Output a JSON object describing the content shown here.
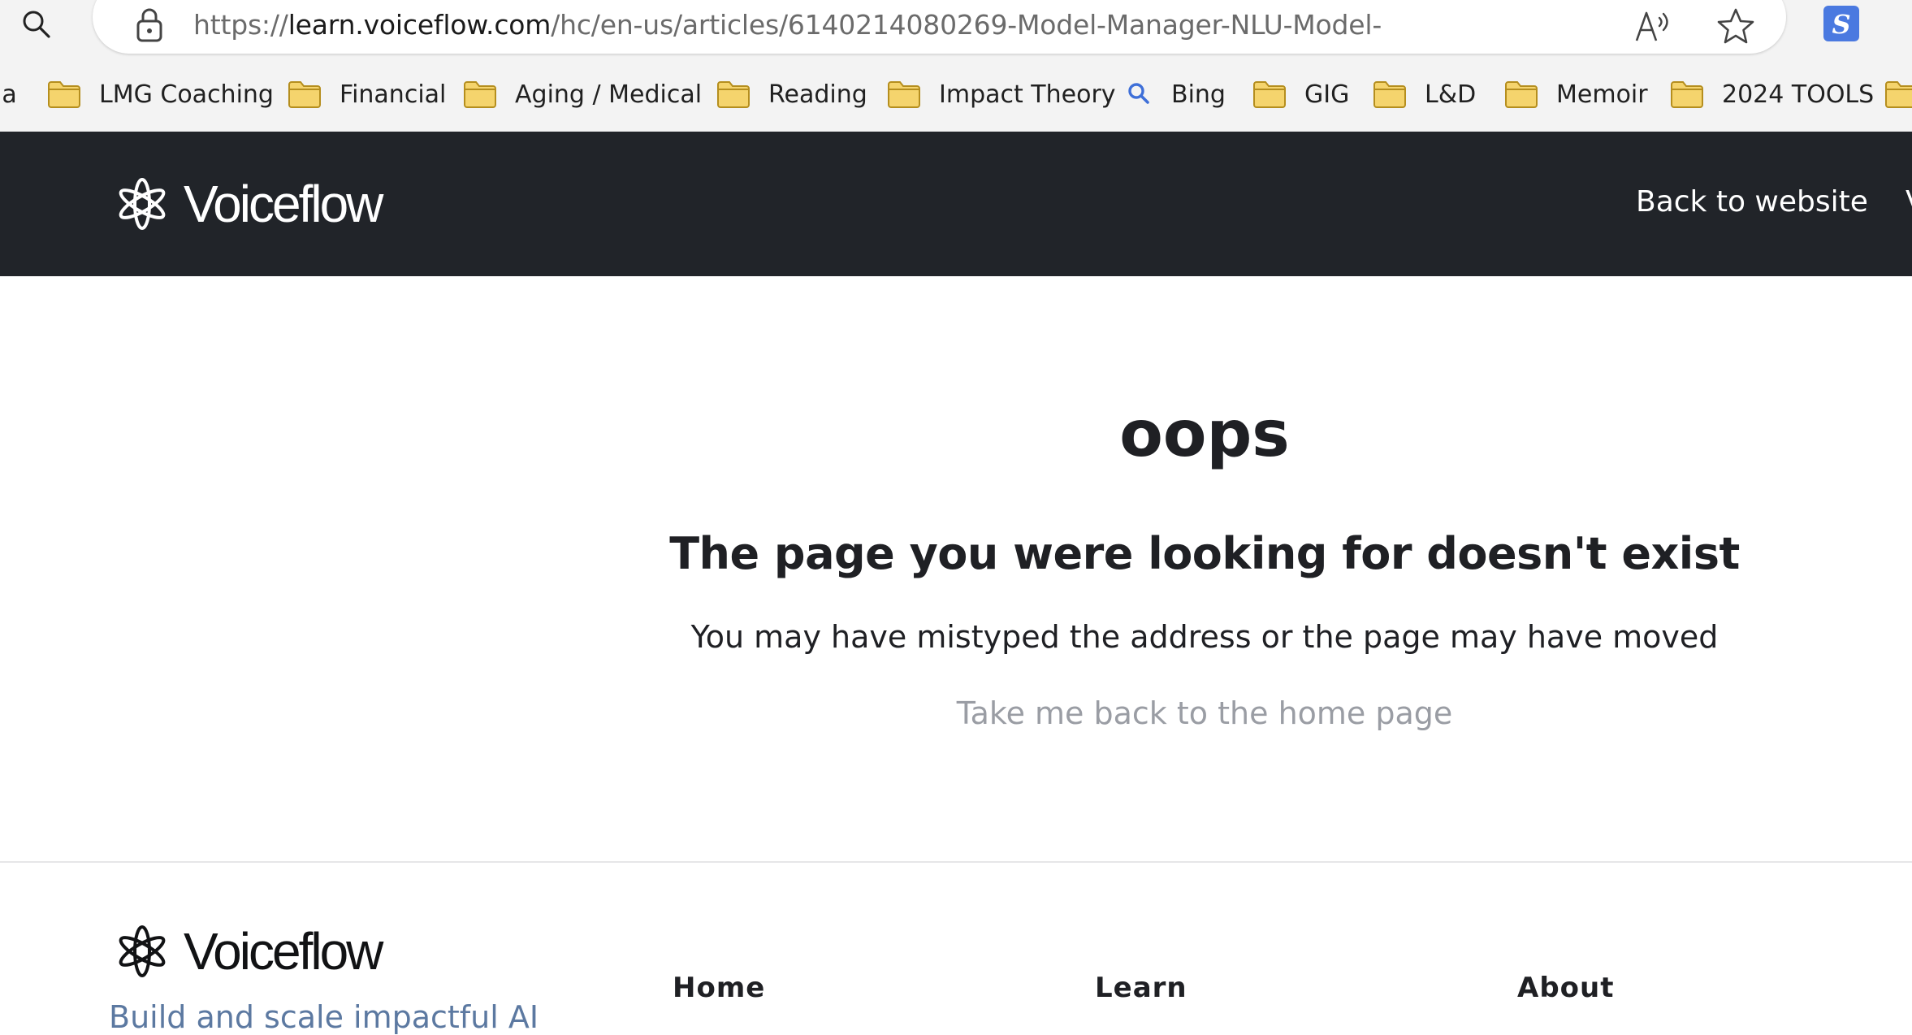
{
  "browser": {
    "url_prefix": "https://",
    "url_host": "learn.voiceflow.com",
    "url_path": "/hc/en-us/articles/6140214080269-Model-Manager-NLU-Model-",
    "bookmarks": [
      {
        "label": "ia",
        "icon": "none"
      },
      {
        "label": "LMG Coaching",
        "icon": "folder-icon"
      },
      {
        "label": "Financial",
        "icon": "folder-icon"
      },
      {
        "label": "Aging / Medical",
        "icon": "folder-icon"
      },
      {
        "label": "Reading",
        "icon": "folder-icon"
      },
      {
        "label": "Impact Theory",
        "icon": "folder-icon"
      },
      {
        "label": "Bing",
        "icon": "search-icon"
      },
      {
        "label": "GIG",
        "icon": "folder-icon"
      },
      {
        "label": "L&D",
        "icon": "folder-icon"
      },
      {
        "label": "Memoir",
        "icon": "folder-icon"
      },
      {
        "label": "2024 TOOLS",
        "icon": "folder-icon"
      }
    ]
  },
  "header": {
    "logo_text": "Voiceflow",
    "back_link": "Back to website",
    "edge_glyph": "V"
  },
  "main": {
    "title": "oops",
    "subtitle": "The page you were looking for doesn't exist",
    "message": "You may have mistyped the address or the page may have moved",
    "home_link": "Take me back to the home page"
  },
  "footer": {
    "logo_text": "Voiceflow",
    "tagline": "Build and scale impactful AI",
    "columns": [
      "Home",
      "Learn",
      "About"
    ]
  },
  "colors": {
    "header_bg": "#212429",
    "folder": "#f5d46d",
    "link_muted": "#9a9da4",
    "tagline": "#5c79a1",
    "extension": "#4a79e0"
  }
}
